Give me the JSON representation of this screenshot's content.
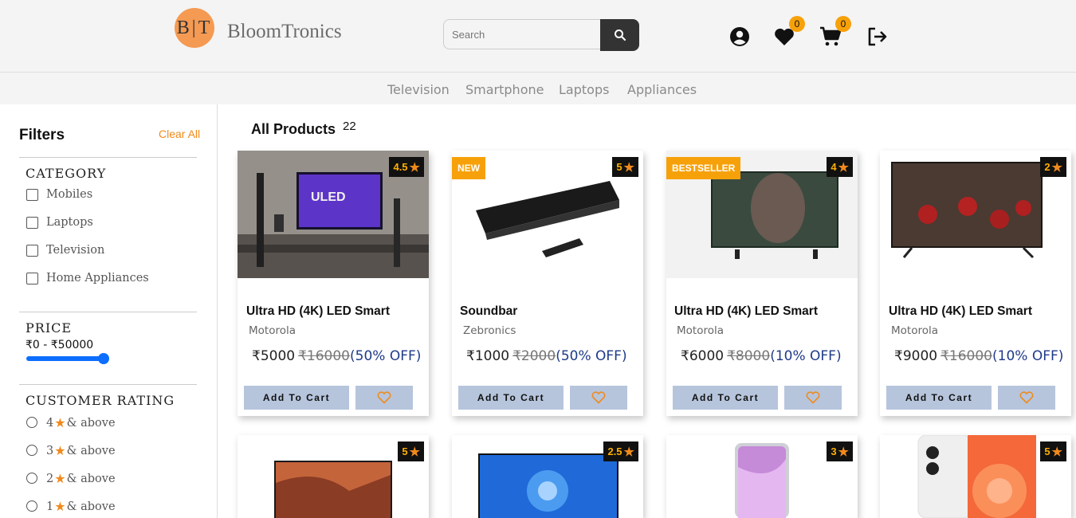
{
  "header": {
    "logo_letters": "B|T",
    "brand": "BloomTronics",
    "search_placeholder": "Search",
    "wishlist_count": "0",
    "cart_count": "0"
  },
  "nav": {
    "items": [
      "Television",
      "Smartphone",
      "Laptops",
      "Appliances"
    ]
  },
  "sidebar": {
    "title": "Filters",
    "clear_all": "Clear All",
    "category_title": "CATEGORY",
    "categories": [
      "Mobiles",
      "Laptops",
      "Television",
      "Home Appliances"
    ],
    "price_title": "PRICE",
    "price_range": "₹0 - ₹50000",
    "price_fill_fraction": 1.0,
    "rating_title": "CUSTOMER RATING",
    "ratings": [
      {
        "value": "4",
        "suffix": "& above"
      },
      {
        "value": "3",
        "suffix": "& above"
      },
      {
        "value": "2",
        "suffix": "& above"
      },
      {
        "value": "1",
        "suffix": "& above"
      }
    ]
  },
  "main": {
    "title": "All Products",
    "count": "22",
    "add_to_cart_label": "Add To Cart",
    "products": [
      {
        "rating": "4.5",
        "tag": "",
        "name": "Ultra HD (4K) LED Smart",
        "brand": "Motorola",
        "price": "₹5000",
        "old_price": "₹16000",
        "off": "(50% OFF)"
      },
      {
        "rating": "5",
        "tag": "NEW",
        "name": "Soundbar",
        "brand": "Zebronics",
        "price": "₹1000",
        "old_price": "₹2000",
        "off": "(50% OFF)"
      },
      {
        "rating": "4",
        "tag": "BESTSELLER",
        "name": "Ultra HD (4K) LED Smart",
        "brand": "Motorola",
        "price": "₹6000",
        "old_price": "₹8000",
        "off": "(10% OFF)"
      },
      {
        "rating": "2",
        "tag": "",
        "name": "Ultra HD (4K) LED Smart",
        "brand": "Motorola",
        "price": "₹9000",
        "old_price": "₹16000",
        "off": "(10% OFF)"
      },
      {
        "rating": "5"
      },
      {
        "rating": "2.5"
      },
      {
        "rating": "3"
      },
      {
        "rating": "5"
      }
    ]
  },
  "colors": {
    "accent": "#f08a1c",
    "badge": "#f7a10a",
    "button": "#b6c5dc",
    "slider": "#0d6efd"
  }
}
